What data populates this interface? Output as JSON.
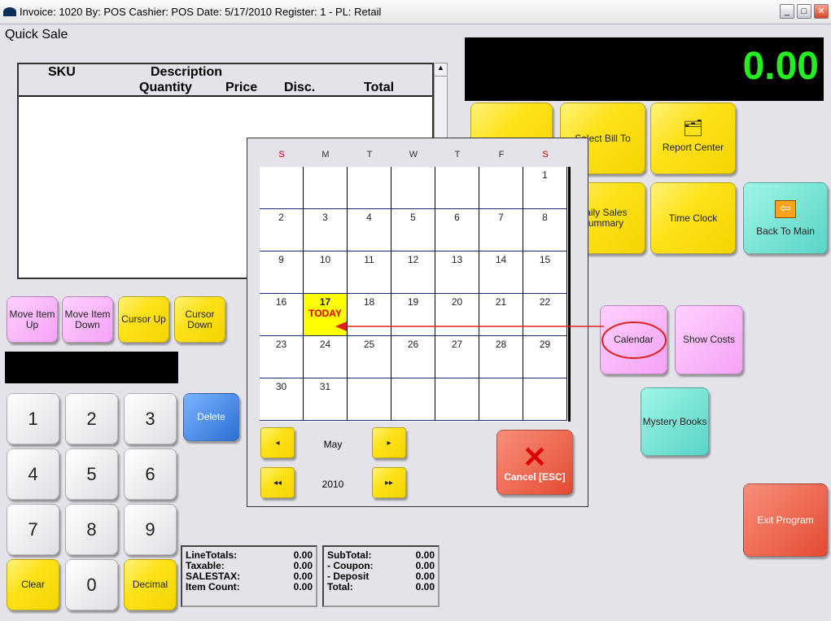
{
  "window": {
    "title": "Invoice: 1020  By: POS  Cashier: POS   Date:  5/17/2010  Register: 1 - PL: Retail",
    "min": "_",
    "max": "□",
    "close": "✕"
  },
  "screen_title": "Quick Sale",
  "grid": {
    "headers": {
      "sku": "SKU",
      "description": "Description",
      "quantity": "Quantity",
      "price": "Price",
      "disc": "Disc.",
      "total": "Total"
    }
  },
  "display": {
    "amount": "0.00",
    "color": "#22ee22"
  },
  "left_buttons": [
    "Move Item Up",
    "Move Item Down",
    "Cursor Up",
    "Cursor Down"
  ],
  "keypad": [
    "1",
    "2",
    "3",
    "4",
    "5",
    "6",
    "7",
    "8",
    "9",
    "Clear",
    "0",
    "Decimal"
  ],
  "delete_label": "Delete",
  "totals_left": [
    {
      "label": "LineTotals:",
      "value": "0.00"
    },
    {
      "label": "Taxable:",
      "value": "0.00"
    },
    {
      "label": "SALESTAX:",
      "value": "0.00"
    },
    {
      "label": "Item Count:",
      "value": "0.00"
    }
  ],
  "totals_right": [
    {
      "label": "SubTotal:",
      "value": "0.00"
    },
    {
      "label": "- Coupon:",
      "value": "0.00"
    },
    {
      "label": "- Deposit",
      "value": "0.00"
    },
    {
      "label": "Total:",
      "value": "0.00"
    }
  ],
  "right_buttons": {
    "select_bill_to": "Select Bill To",
    "report_center": "Report Center",
    "daily_sales": "Daily Sales Summary",
    "time_clock": "Time Clock",
    "back_to_main": "Back To Main",
    "calendar": "Calendar",
    "show_costs": "Show Costs",
    "mystery_books": "Mystery Books",
    "exit_program": "Exit Program"
  },
  "calendar": {
    "days_of_week": [
      "S",
      "M",
      "T",
      "W",
      "T",
      "F",
      "S"
    ],
    "month": "May",
    "year": "2010",
    "today_label": "TODAY",
    "today": 17,
    "first_weekday": 6,
    "days_in_month": 31,
    "weekend_color": "#cc0000",
    "prev_month": "◂",
    "next_month": "▸",
    "prev_year": "◂◂",
    "next_year": "▸▸",
    "cancel_label": "Cancel [ESC]"
  }
}
